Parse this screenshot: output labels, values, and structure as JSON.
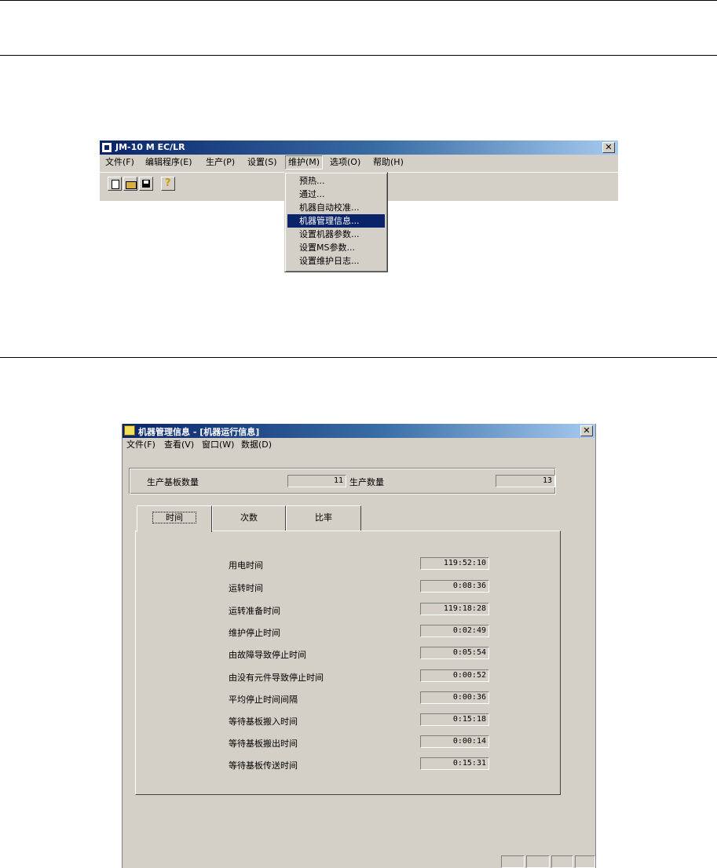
{
  "window1": {
    "title": "JM-10 M EC/LR",
    "close": "✕",
    "menu": [
      "文件(F)",
      "编辑程序(E)",
      "生产(P)",
      "设置(S)",
      "维护(M)",
      "选项(O)",
      "帮助(H)"
    ],
    "toolbar_icons": [
      "new-icon",
      "open-icon",
      "save-icon",
      "help-icon"
    ],
    "help_glyph": "?",
    "dropdown": [
      "预热...",
      "通过...",
      "机器自动校准...",
      "机器管理信息...",
      "设置机器参数...",
      "设置MS参数...",
      "设置维护日志..."
    ],
    "dropdown_selected": 3
  },
  "window2": {
    "title": "机器管理信息 - [机器运行信息]",
    "close": "✕",
    "menu": [
      "文件(F)",
      "查看(V)",
      "窗口(W)",
      "数据(D)"
    ],
    "summary": {
      "boards_label": "生产基板数量",
      "boards_value": "11",
      "count_label": "生产数量",
      "count_value": "13"
    },
    "tabs": [
      "时间",
      "次数",
      "比率"
    ],
    "active_tab": 0,
    "rows": [
      {
        "label": "用电时间",
        "value": "119:52:10"
      },
      {
        "label": "运转时间",
        "value": "0:08:36"
      },
      {
        "label": "运转准备时间",
        "value": "119:18:28"
      },
      {
        "label": "维护停止时间",
        "value": "0:02:49"
      },
      {
        "label": "由故障导致停止时间",
        "value": "0:05:54"
      },
      {
        "label": "由没有元件导致停止时间",
        "value": "0:00:52"
      },
      {
        "label": "平均停止时间间隔",
        "value": "0:00:36"
      },
      {
        "label": "等待基板搬入时间",
        "value": "0:15:18"
      },
      {
        "label": "等待基板搬出时间",
        "value": "0:00:14"
      },
      {
        "label": "等待基板传送时间",
        "value": "0:15:31"
      }
    ]
  }
}
